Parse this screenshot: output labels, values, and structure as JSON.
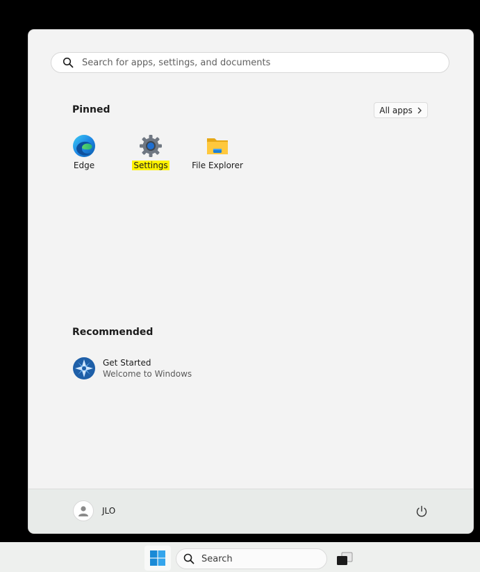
{
  "start_menu": {
    "search": {
      "placeholder": "Search for apps, settings, and documents"
    },
    "pinned": {
      "title": "Pinned",
      "all_apps_label": "All apps",
      "apps": [
        {
          "label": "Edge",
          "icon": "edge-icon"
        },
        {
          "label": "Settings",
          "icon": "gear-icon",
          "highlighted": true
        },
        {
          "label": "File Explorer",
          "icon": "folder-icon"
        }
      ]
    },
    "recommended": {
      "title": "Recommended",
      "items": [
        {
          "title": "Get Started",
          "subtitle": "Welcome to Windows",
          "icon": "get-started-icon"
        }
      ]
    },
    "footer": {
      "user_name": "JLO",
      "power_icon": "power-icon"
    }
  },
  "taskbar": {
    "search_label": "Search",
    "start_icon": "windows-logo-icon",
    "task_view_icon": "task-view-icon"
  },
  "colors": {
    "highlight": "#fff200",
    "accent": "#0067c0"
  }
}
